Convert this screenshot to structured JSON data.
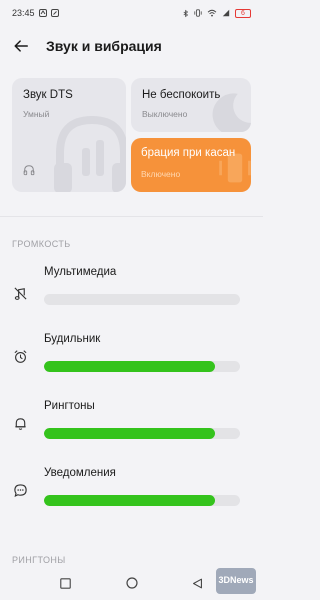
{
  "status_bar": {
    "time": "23:45",
    "battery": "6"
  },
  "header": {
    "title": "Звук и вибрация"
  },
  "tiles": {
    "dts": {
      "title": "Звук DTS",
      "subtitle": "Умный"
    },
    "dnd": {
      "title": "Не беспокоить",
      "subtitle": "Выключено"
    },
    "vibration": {
      "title": "брация при касан",
      "subtitle": "Включено"
    }
  },
  "volume": {
    "section_label": "ГРОМКОСТЬ",
    "items": [
      {
        "label": "Мультимедиа",
        "level": 0.0,
        "icon": "muted-note-icon"
      },
      {
        "label": "Будильник",
        "level": 0.87,
        "icon": "alarm-clock-icon"
      },
      {
        "label": "Рингтоны",
        "level": 0.87,
        "icon": "bell-icon"
      },
      {
        "label": "Уведомления",
        "level": 0.87,
        "icon": "message-icon"
      }
    ]
  },
  "ringtones_section": {
    "section_label": "РИНГТОНЫ"
  },
  "colors": {
    "accent_green": "#34c31c",
    "vibration_tile": "#f6923a",
    "battery_low": "#e53935"
  },
  "watermark": {
    "text": "3DNews"
  }
}
